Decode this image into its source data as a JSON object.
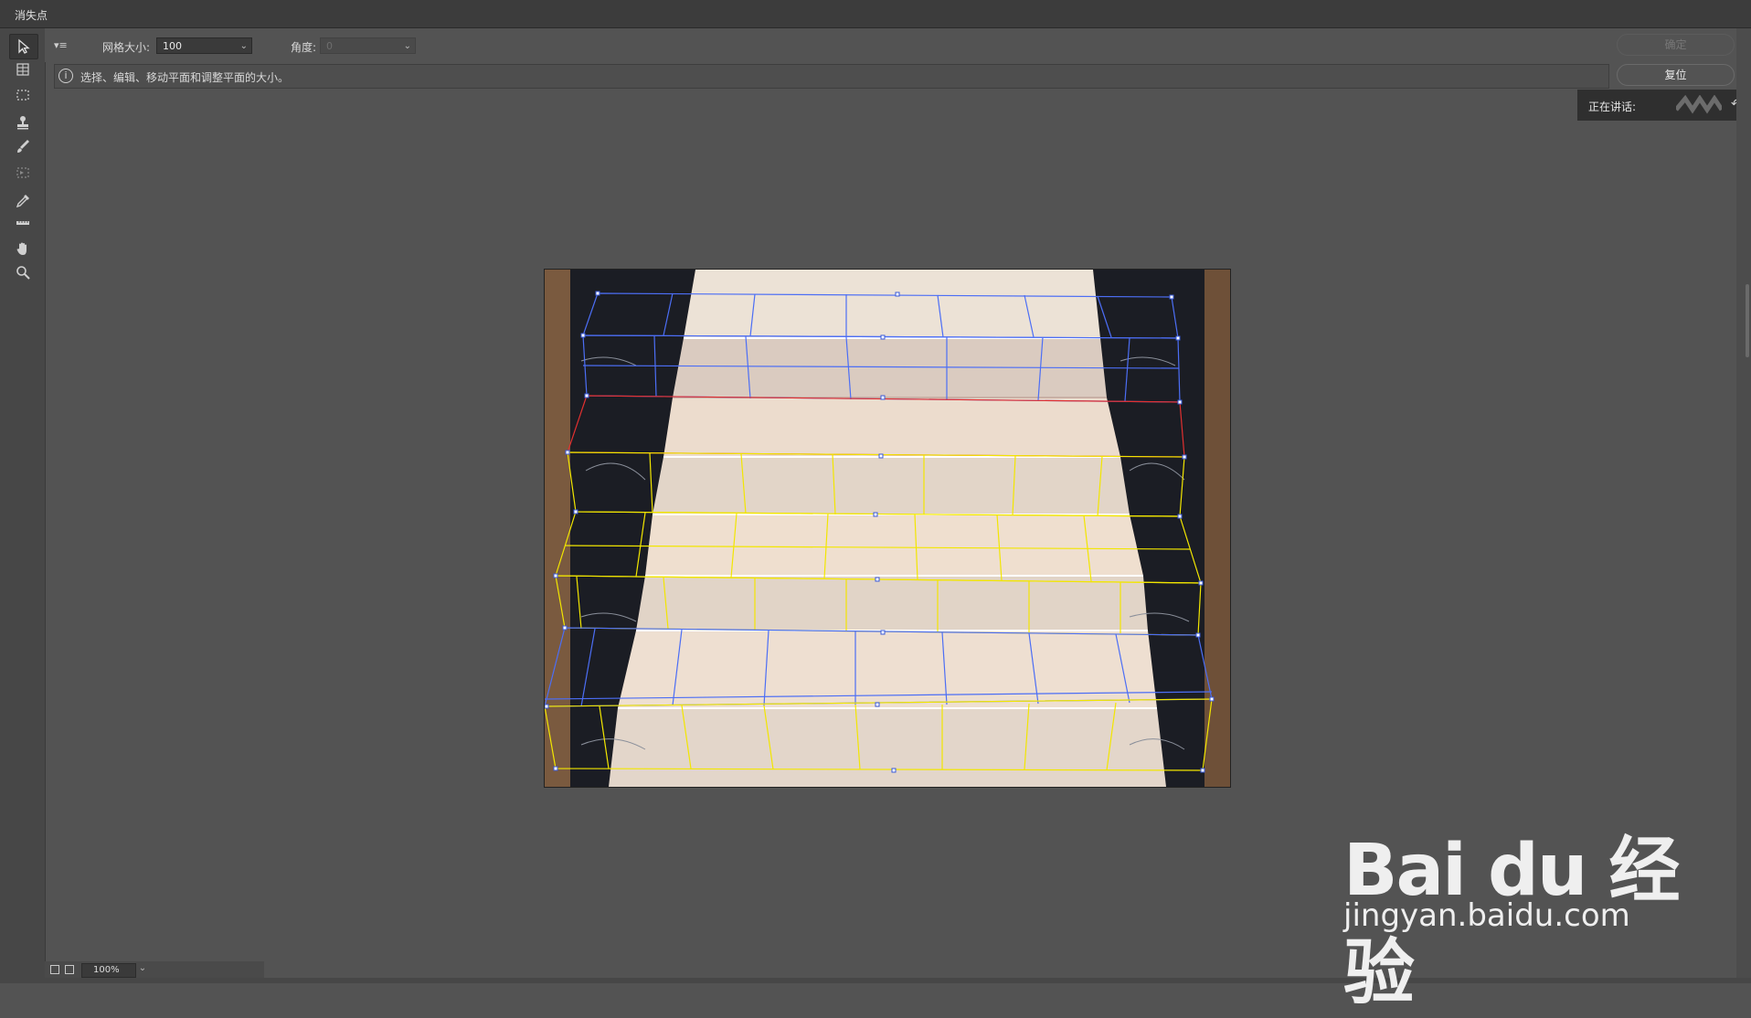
{
  "window": {
    "title": "消失点"
  },
  "options": {
    "grid_size_label": "网格大小:",
    "grid_size_value": "100",
    "angle_label": "角度:",
    "angle_value": "0",
    "ok_label": "确定",
    "reset_label": "复位"
  },
  "info": {
    "text": "选择、编辑、移动平面和调整平面的大小。"
  },
  "speaking": {
    "label": "正在讲话:"
  },
  "status": {
    "zoom": "100%"
  },
  "watermark": {
    "logo_text": "Bai du 经验",
    "url": "jingyan.baidu.com"
  },
  "colors": {
    "plane_blue": "#4c6ef5",
    "plane_yellow": "#f2e600",
    "plane_red": "#e23030",
    "background": "#535353"
  }
}
